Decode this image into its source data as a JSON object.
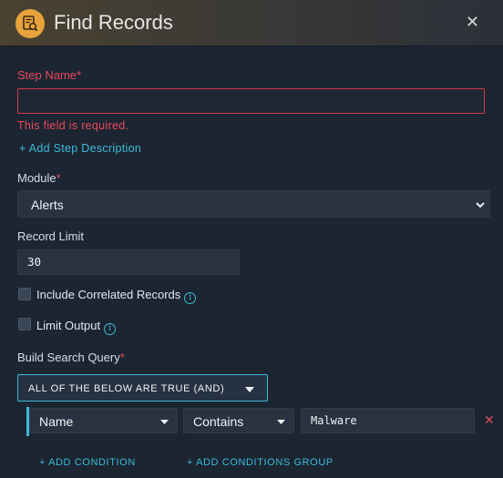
{
  "dialog": {
    "title": "Find Records",
    "close_glyph": "✕"
  },
  "step_name": {
    "label": "Step Name",
    "required_mark": "*",
    "value": "",
    "error": "This field is required."
  },
  "add_description_link": "+ Add Step Description",
  "module": {
    "label": "Module",
    "required_mark": "*",
    "value": "Alerts"
  },
  "record_limit": {
    "label": "Record Limit",
    "value": "30"
  },
  "include_correlated": {
    "label": "Include Correlated Records",
    "checked": false
  },
  "limit_output": {
    "label": "Limit Output",
    "checked": false
  },
  "build_query": {
    "label": "Build Search Query",
    "required_mark": "*",
    "logic": "ALL OF THE BELOW ARE TRUE (AND)",
    "condition": {
      "field": "Name",
      "operator": "Contains",
      "value": "Malware"
    },
    "add_condition": "+ ADD CONDITION",
    "add_group": "+ ADD CONDITIONS GROUP"
  },
  "colors": {
    "accent": "#3cbcd6",
    "error": "#e84a5a",
    "background": "#1c2532",
    "header_icon": "#e8a33c"
  },
  "icons": {
    "header": "find-records-icon",
    "info": "info-icon",
    "close": "close-icon",
    "remove": "remove-condition-icon"
  }
}
